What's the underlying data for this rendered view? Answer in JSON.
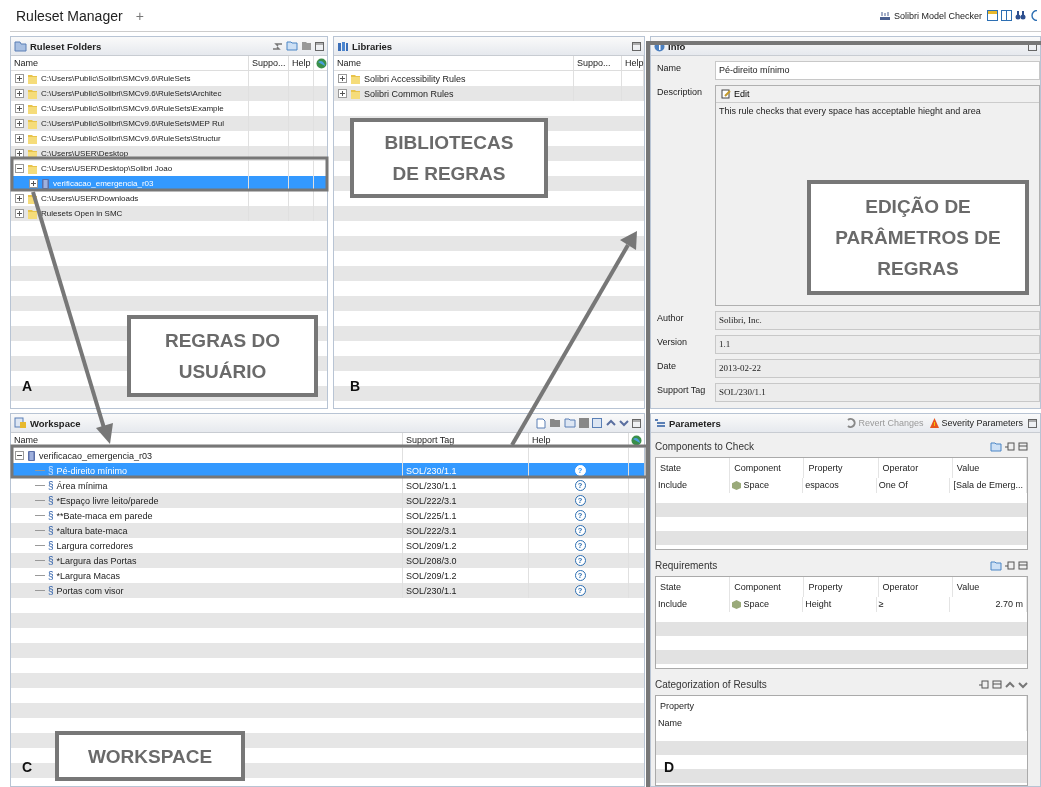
{
  "app": {
    "title": "Ruleset Manager",
    "add_tab": "+",
    "product": "Solibri Model Checker"
  },
  "ruleset_folders": {
    "title": "Ruleset Folders",
    "columns": [
      "Name",
      "Suppo...",
      "Help"
    ],
    "corner_label": "A",
    "items": [
      {
        "label": "C:\\Users\\Public\\Solibri\\SMCv9.6\\RuleSets",
        "kind": "folder",
        "expanded": false,
        "selected": false
      },
      {
        "label": "C:\\Users\\Public\\Solibri\\SMCv9.6\\RuleSets\\Architec",
        "kind": "folder",
        "expanded": false,
        "selected": false
      },
      {
        "label": "C:\\Users\\Public\\Solibri\\SMCv9.6\\RuleSets\\Example",
        "kind": "folder",
        "expanded": false,
        "selected": false
      },
      {
        "label": "C:\\Users\\Public\\Solibri\\SMCv9.6\\RuleSets\\MEP Rul",
        "kind": "folder",
        "expanded": false,
        "selected": false
      },
      {
        "label": "C:\\Users\\Public\\Solibri\\SMCv9.6\\RuleSets\\Structur",
        "kind": "folder",
        "expanded": false,
        "selected": false
      },
      {
        "label": "C:\\Users\\USER\\Desktop",
        "kind": "folder",
        "expanded": false,
        "selected": false
      },
      {
        "label": "C:\\Users\\USER\\Desktop\\Solibri Joao",
        "kind": "folder",
        "expanded": true,
        "selected": false,
        "children": [
          {
            "label": "verificacao_emergencia_r03",
            "kind": "ruleset",
            "expanded": false,
            "selected": true
          }
        ]
      },
      {
        "label": "C:\\Users\\USER\\Downloads",
        "kind": "folder",
        "expanded": false,
        "selected": false
      },
      {
        "label": "Rulesets Open in SMC",
        "kind": "folder",
        "expanded": false,
        "selected": false
      }
    ]
  },
  "libraries": {
    "title": "Libraries",
    "columns": [
      "Name",
      "Suppo...",
      "Help"
    ],
    "corner_label": "B",
    "items": [
      {
        "label": "Solibri Accessibility Rules",
        "kind": "folder",
        "expanded": false,
        "selected": false
      },
      {
        "label": "Solibri Common Rules",
        "kind": "folder",
        "expanded": false,
        "selected": false
      }
    ]
  },
  "workspace": {
    "title": "Workspace",
    "columns": [
      "Name",
      "Support Tag",
      "Help"
    ],
    "corner_label": "C",
    "items": [
      {
        "label": "verificacao_emergencia_r03",
        "kind": "ruleset",
        "expanded": true,
        "selected": false,
        "children": [
          {
            "label": "Pé-direito mínimo",
            "kind": "rule",
            "marker": "§",
            "support_tag": "SOL/230/1.1",
            "help": "?",
            "selected": true
          },
          {
            "label": "Área mínima",
            "kind": "rule",
            "marker": "§",
            "support_tag": "SOL/230/1.1",
            "help": "?",
            "selected": false
          },
          {
            "label": "*Espaço livre leito/parede",
            "kind": "rule",
            "marker": "§",
            "support_tag": "SOL/222/3.1",
            "help": "?",
            "selected": false
          },
          {
            "label": "**Bate-maca em parede",
            "kind": "rule",
            "marker": "§",
            "support_tag": "SOL/225/1.1",
            "help": "?",
            "selected": false
          },
          {
            "label": "*altura bate-maca",
            "kind": "rule",
            "marker": "§",
            "support_tag": "SOL/222/3.1",
            "help": "?",
            "selected": false
          },
          {
            "label": "Largura corredores",
            "kind": "rule",
            "marker": "§",
            "support_tag": "SOL/209/1.2",
            "help": "?",
            "selected": false
          },
          {
            "label": "*Largura das Portas",
            "kind": "rule",
            "marker": "§",
            "support_tag": "SOL/208/3.0",
            "help": "?",
            "selected": false
          },
          {
            "label": "*Largura Macas",
            "kind": "rule",
            "marker": "§",
            "support_tag": "SOL/209/1.2",
            "help": "?",
            "selected": false
          },
          {
            "label": "Portas com visor",
            "kind": "rule",
            "marker": "§",
            "support_tag": "SOL/230/1.1",
            "help": "?",
            "selected": false
          }
        ]
      }
    ]
  },
  "info": {
    "title": "Info",
    "name": {
      "label": "Name",
      "value": "Pé-direito mínimo"
    },
    "description": {
      "label": "Description",
      "edit": "Edit",
      "text": "This rule checks that every space has acceptable hieght and area"
    },
    "fields": [
      {
        "label": "Author",
        "value": "Solibri, Inc."
      },
      {
        "label": "Version",
        "value": "1.1"
      },
      {
        "label": "Date",
        "value": "2013-02-22"
      },
      {
        "label": "Support Tag",
        "value": "SOL/230/1.1"
      }
    ]
  },
  "parameters": {
    "title": "Parameters",
    "corner_label": "D",
    "actions": [
      {
        "label": "Revert Changes",
        "kind": "revert",
        "disabled": true
      },
      {
        "label": "Severity Parameters",
        "kind": "severity",
        "disabled": false
      }
    ],
    "sections": [
      {
        "title": "Components to Check",
        "columns": [
          "State",
          "Component",
          "Property",
          "Operator",
          "Value"
        ],
        "rows": [
          [
            "Include",
            "Space",
            "espacos",
            "One Of",
            "[Sala de Emerg..."
          ]
        ]
      },
      {
        "title": "Requirements",
        "columns": [
          "State",
          "Component",
          "Property",
          "Operator",
          "Value"
        ],
        "rows": [
          [
            "Include",
            "Space",
            "Height",
            "≥",
            "2.70 m"
          ]
        ]
      },
      {
        "title": "Categorization of Results",
        "columns": [
          "Property"
        ],
        "rows": [
          [
            "Name"
          ]
        ]
      }
    ]
  },
  "annotations": [
    {
      "lines": [
        "BIBLIOTECAS",
        "DE REGRAS"
      ]
    },
    {
      "lines": [
        "REGRAS DO",
        "USUÁRIO"
      ]
    },
    {
      "lines": [
        "EDIÇÃO DE",
        "PARÂMETROS DE",
        "REGRAS"
      ]
    },
    {
      "lines": [
        "WORKSPACE"
      ]
    }
  ]
}
